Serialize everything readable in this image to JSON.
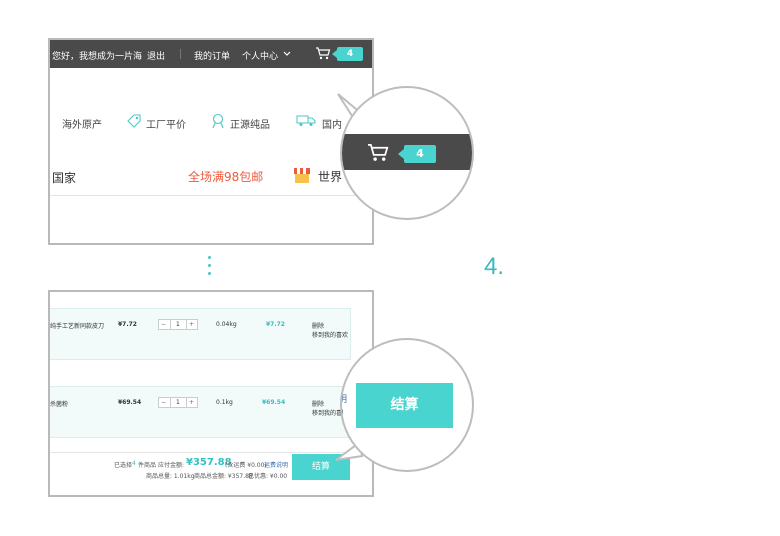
{
  "header": {
    "greeting": "您好，我想成为一片海",
    "logout": "退出",
    "my_orders": "我的订单",
    "personal_center": "个人中心",
    "cart_count": "4"
  },
  "features": [
    {
      "label": "海外原产",
      "icon": "globe-icon"
    },
    {
      "label": "工厂平价",
      "icon": "tag-icon"
    },
    {
      "label": "正源纯品",
      "icon": "badge-icon"
    },
    {
      "label": "国内",
      "icon": "truck-icon"
    }
  ],
  "nav": {
    "country": "国家",
    "promo": "全场满98包邮",
    "world": "世界"
  },
  "zoom_cart": {
    "count": "4"
  },
  "step_label": "4.",
  "cart": {
    "rows": [
      {
        "name": "纯手工艺新同款皮刀",
        "price": "¥7.72",
        "qty": "1",
        "weight": "0.04kg",
        "subtotal": "¥7.72",
        "action_delete": "删除",
        "action_move": "移到我的喜欢"
      },
      {
        "name": "杀菌粉",
        "price": "¥69.54",
        "qty": "1",
        "weight": "0.1kg",
        "subtotal": "¥69.54",
        "action_delete": "删除",
        "action_move": "移到我的喜欢"
      }
    ],
    "summary": {
      "selected_prefix": "已选择",
      "selected_count": "4",
      "selected_suffix": "件商品",
      "payable_label": "应付金额:",
      "total": "¥357.88",
      "shipping_note": "(含运费 ¥0.00)",
      "shipping_link": "运费说明",
      "weight_line": "商品总量: 1.01kg",
      "amount_line": "商品总金额: ¥357.88",
      "discount_line": "已优惠: ¥0.00"
    },
    "checkout_label": "结算"
  },
  "zoom_checkout": {
    "label": "结算",
    "peek_top": "明",
    "peek_bottom": "0"
  },
  "colors": {
    "accent": "#49d4d0",
    "promo": "#ef5a3c",
    "topbar": "#4a4a4a"
  }
}
